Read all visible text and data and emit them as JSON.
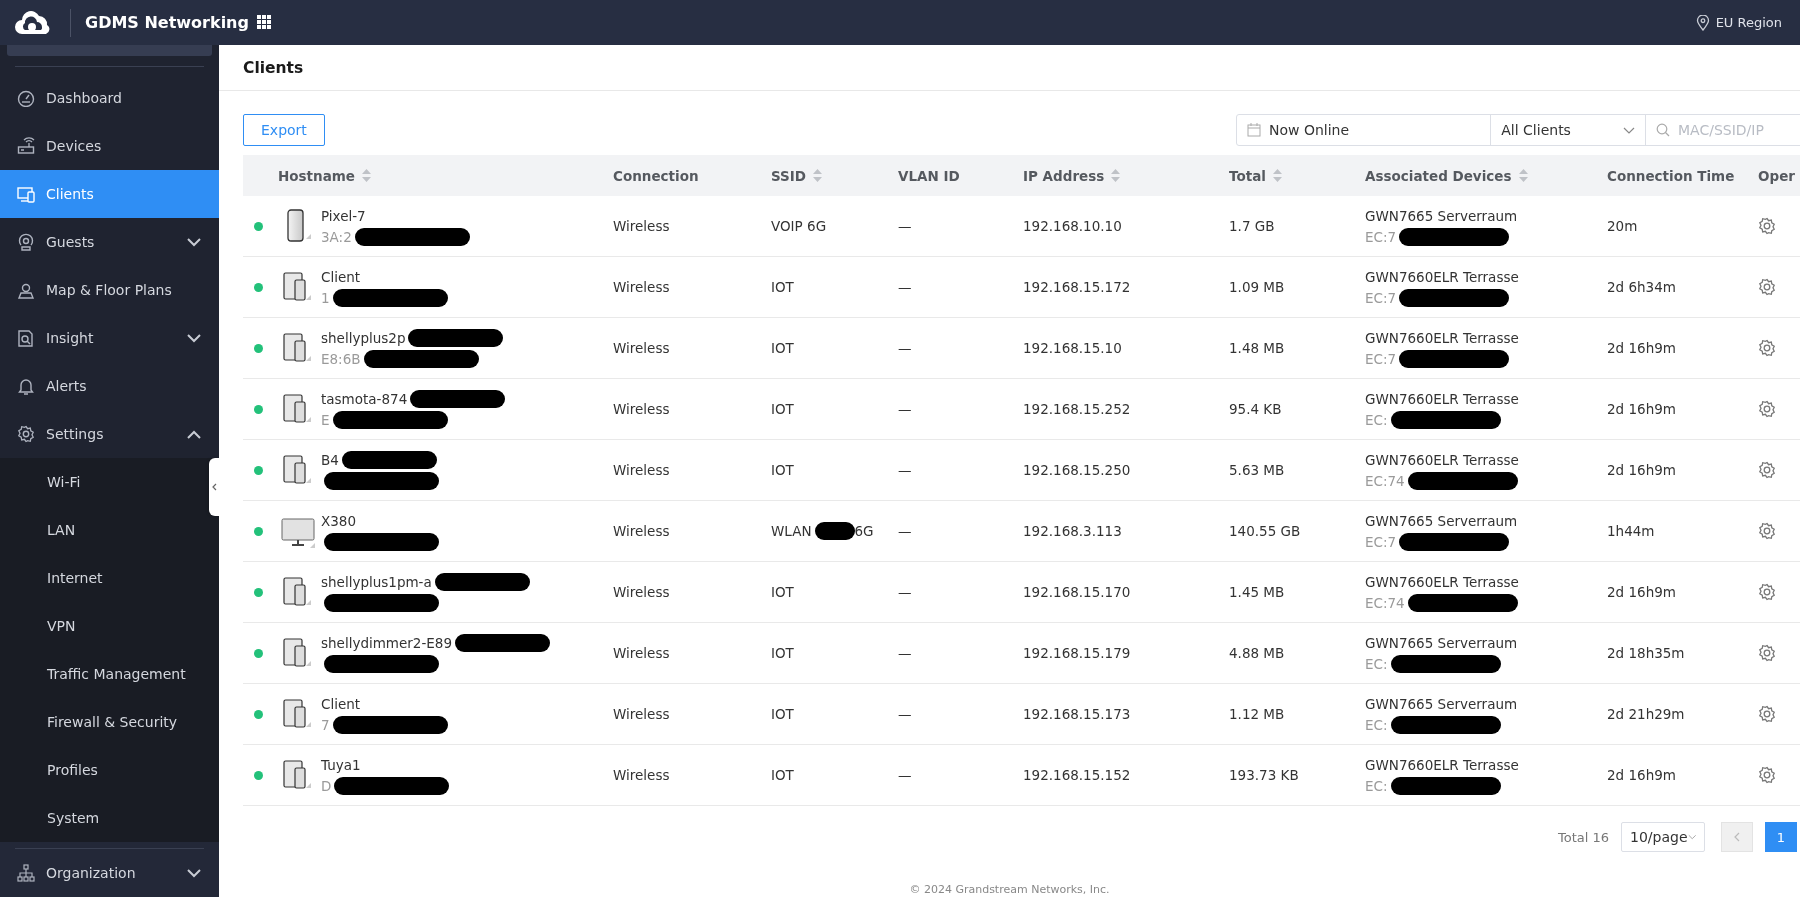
{
  "topbar": {
    "title": "GDMS Networking",
    "region": "EU Region"
  },
  "sidebar": {
    "items": [
      {
        "label": "Dashboard",
        "selected": false
      },
      {
        "label": "Devices",
        "selected": false
      },
      {
        "label": "Clients",
        "selected": true
      },
      {
        "label": "Guests",
        "selected": false,
        "expanded": false
      },
      {
        "label": "Map & Floor Plans",
        "selected": false
      },
      {
        "label": "Insight",
        "selected": false,
        "expanded": false
      },
      {
        "label": "Alerts",
        "selected": false
      },
      {
        "label": "Settings",
        "selected": false,
        "expanded": true,
        "children": [
          {
            "label": "Wi-Fi",
            "selected": false
          },
          {
            "label": "LAN",
            "selected": false
          },
          {
            "label": "Internet",
            "selected": false
          },
          {
            "label": "VPN",
            "selected": false
          },
          {
            "label": "Traffic Management",
            "selected": false
          },
          {
            "label": "Firewall & Security",
            "selected": false
          },
          {
            "label": "Profiles",
            "selected": false
          },
          {
            "label": "System",
            "selected": false
          }
        ]
      }
    ],
    "footer_item": {
      "label": "Organization",
      "expanded": false
    }
  },
  "page": {
    "title": "Clients",
    "export_button": "Export",
    "filters": {
      "time": "Now Online",
      "client_type": "All Clients",
      "search": {
        "placeholder": "MAC/SSID/IP"
      }
    }
  },
  "table": {
    "columns": [
      {
        "label": "Hostname",
        "sortable": true
      },
      {
        "label": "Connection"
      },
      {
        "label": "SSID",
        "sortable": true
      },
      {
        "label": "VLAN ID"
      },
      {
        "label": "IP Address",
        "sortable": true
      },
      {
        "label": "Total",
        "sortable": true
      },
      {
        "label": "Associated Devices",
        "sortable": true
      },
      {
        "label": "Connection Time"
      },
      {
        "label": "Oper"
      }
    ],
    "rows": [
      {
        "online": true,
        "kind": "phone",
        "hostname": "Pixel-7",
        "hostname_redacted": false,
        "mac": "3A:2",
        "connection": "Wireless",
        "ssid": "VOIP 6G",
        "vlan": "—",
        "ip": "192.168.10.10",
        "total": "1.7 GB",
        "device": "GWN7665 Serverraum",
        "device_mac": "EC:7",
        "time": "20m"
      },
      {
        "online": true,
        "kind": "tablet",
        "hostname": "Client",
        "hostname_redacted": false,
        "mac": "1",
        "connection": "Wireless",
        "ssid": "IOT",
        "vlan": "—",
        "ip": "192.168.15.172",
        "total": "1.09 MB",
        "device": "GWN7660ELR Terrasse",
        "device_mac": "EC:7",
        "time": "2d 6h34m"
      },
      {
        "online": true,
        "kind": "tablet",
        "hostname": "shellyplus2p",
        "hostname_redacted": true,
        "mac": "E8:6B",
        "connection": "Wireless",
        "ssid": "IOT",
        "vlan": "—",
        "ip": "192.168.15.10",
        "total": "1.48 MB",
        "device": "GWN7660ELR Terrasse",
        "device_mac": "EC:7",
        "time": "2d 16h9m"
      },
      {
        "online": true,
        "kind": "tablet",
        "hostname": "tasmota-874",
        "hostname_redacted": true,
        "mac": "E",
        "connection": "Wireless",
        "ssid": "IOT",
        "vlan": "—",
        "ip": "192.168.15.252",
        "total": "95.4 KB",
        "device": "GWN7660ELR Terrasse",
        "device_mac": "EC:",
        "time": "2d 16h9m"
      },
      {
        "online": true,
        "kind": "tablet",
        "hostname": "B4",
        "hostname_redacted": true,
        "connection": "Wireless",
        "ssid": "IOT",
        "vlan": "—",
        "ip": "192.168.15.250",
        "total": "5.63 MB",
        "device": "GWN7660ELR Terrasse",
        "device_mac": "EC:74",
        "time": "2d 16h9m"
      },
      {
        "online": true,
        "kind": "desktop",
        "hostname": "X380",
        "hostname_redacted": false,
        "connection": "Wireless",
        "ssid": "WLAN",
        "ssid_tail": "6G",
        "vlan": "—",
        "ip": "192.168.3.113",
        "total": "140.55 GB",
        "device": "GWN7665 Serverraum",
        "device_mac": "EC:7",
        "time": "1h44m"
      },
      {
        "online": true,
        "kind": "tablet",
        "hostname": "shellyplus1pm-a",
        "hostname_redacted": true,
        "connection": "Wireless",
        "ssid": "IOT",
        "vlan": "—",
        "ip": "192.168.15.170",
        "total": "1.45 MB",
        "device": "GWN7660ELR Terrasse",
        "device_mac": "EC:74",
        "time": "2d 16h9m"
      },
      {
        "online": true,
        "kind": "tablet",
        "hostname": "shellydimmer2-E89",
        "hostname_redacted": true,
        "connection": "Wireless",
        "ssid": "IOT",
        "vlan": "—",
        "ip": "192.168.15.179",
        "total": "4.88 MB",
        "device": "GWN7665 Serverraum",
        "device_mac": "EC:",
        "time": "2d 18h35m"
      },
      {
        "online": true,
        "kind": "tablet",
        "hostname": "Client",
        "hostname_redacted": false,
        "mac": "7",
        "connection": "Wireless",
        "ssid": "IOT",
        "vlan": "—",
        "ip": "192.168.15.173",
        "total": "1.12 MB",
        "device": "GWN7665 Serverraum",
        "device_mac": "EC:",
        "time": "2d 21h29m"
      },
      {
        "online": true,
        "kind": "tablet",
        "hostname": "Tuya1",
        "hostname_redacted": false,
        "mac": "D",
        "connection": "Wireless",
        "ssid": "IOT",
        "vlan": "—",
        "ip": "192.168.15.152",
        "total": "193.73 KB",
        "device": "GWN7660ELR Terrasse",
        "device_mac": "EC:",
        "time": "2d 16h9m"
      }
    ]
  },
  "pagination": {
    "total": "Total 16",
    "page_size": "10/page",
    "pages": [
      {
        "label": "1",
        "selected": true
      }
    ]
  },
  "footer": "© 2024 Grandstream Networks, Inc."
}
